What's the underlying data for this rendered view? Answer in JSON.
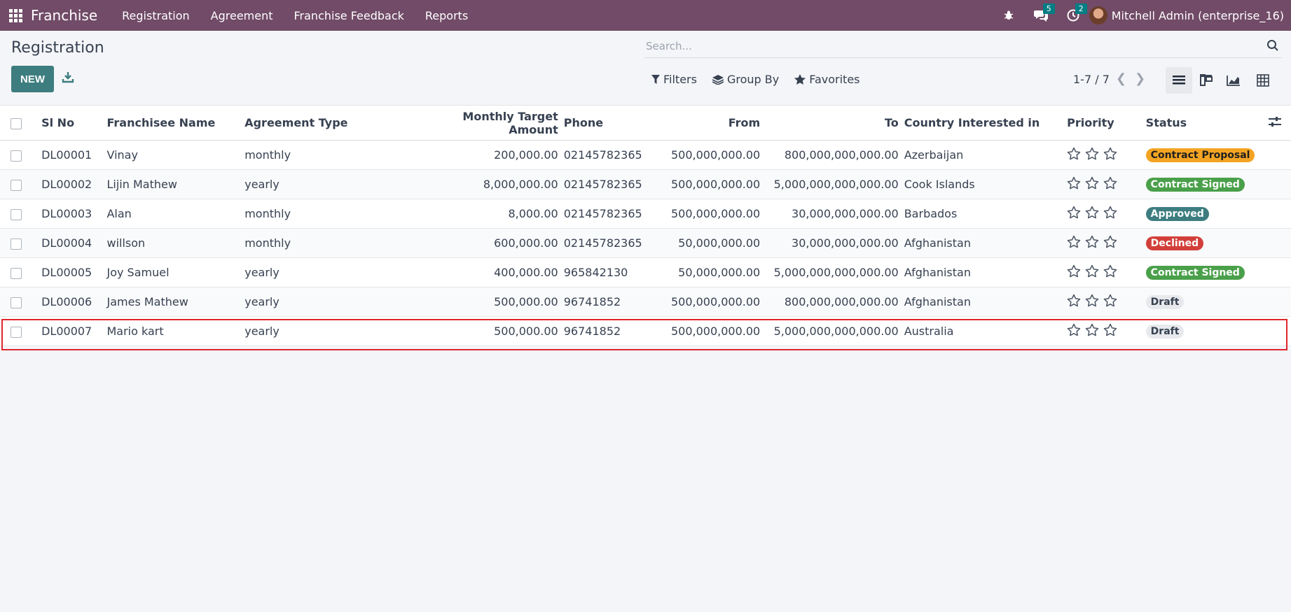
{
  "app": {
    "name": "Franchise"
  },
  "nav": {
    "menu": [
      "Registration",
      "Agreement",
      "Franchise Feedback",
      "Reports"
    ]
  },
  "systray": {
    "messages_count": "5",
    "activities_count": "2",
    "user": "Mitchell Admin (enterprise_16)"
  },
  "page": {
    "title": "Registration",
    "new_label": "NEW"
  },
  "search": {
    "placeholder": "Search..."
  },
  "filters": {
    "filters_label": "Filters",
    "group_by_label": "Group By",
    "favorites_label": "Favorites"
  },
  "pager": {
    "text": "1-7 / 7"
  },
  "table": {
    "columns": [
      "Sl No",
      "Franchisee Name",
      "Agreement Type",
      "Monthly Target Amount",
      "Phone",
      "From",
      "To",
      "Country Interested in",
      "Priority",
      "Status"
    ],
    "rows": [
      {
        "sl": "DL00001",
        "name": "Vinay",
        "type": "monthly",
        "target": "200,000.00",
        "phone": "02145782365",
        "from": "500,000,000.00",
        "to": "800,000,000,000.00",
        "country": "Azerbaijan",
        "status": "Contract Proposal",
        "status_color": "#f3a423",
        "status_text_color": "#1f1f1f"
      },
      {
        "sl": "DL00002",
        "name": "Lijin Mathew",
        "type": "yearly",
        "target": "8,000,000.00",
        "phone": "02145782365",
        "from": "500,000,000.00",
        "to": "5,000,000,000,000.00",
        "country": "Cook Islands",
        "status": "Contract Signed",
        "status_color": "#4aa04a",
        "status_text_color": "#ffffff"
      },
      {
        "sl": "DL00003",
        "name": "Alan",
        "type": "monthly",
        "target": "8,000.00",
        "phone": "02145782365",
        "from": "500,000,000.00",
        "to": "30,000,000,000.00",
        "country": "Barbados",
        "status": "Approved",
        "status_color": "#3d7d80",
        "status_text_color": "#ffffff"
      },
      {
        "sl": "DL00004",
        "name": "willson",
        "type": "monthly",
        "target": "600,000.00",
        "phone": "02145782365",
        "from": "50,000,000.00",
        "to": "30,000,000,000.00",
        "country": "Afghanistan",
        "status": "Declined",
        "status_color": "#d23f3a",
        "status_text_color": "#ffffff"
      },
      {
        "sl": "DL00005",
        "name": "Joy Samuel",
        "type": "yearly",
        "target": "400,000.00",
        "phone": "965842130",
        "from": "50,000,000.00",
        "to": "5,000,000,000,000.00",
        "country": "Afghanistan",
        "status": "Contract Signed",
        "status_color": "#4aa04a",
        "status_text_color": "#ffffff"
      },
      {
        "sl": "DL00006",
        "name": "James Mathew",
        "type": "yearly",
        "target": "500,000.00",
        "phone": "96741852",
        "from": "500,000,000.00",
        "to": "800,000,000,000.00",
        "country": "Afghanistan",
        "status": "Draft",
        "status_color": "#e7e9ed",
        "status_text_color": "#374151"
      },
      {
        "sl": "DL00007",
        "name": "Mario kart",
        "type": "yearly",
        "target": "500,000.00",
        "phone": "96741852",
        "from": "500,000,000.00",
        "to": "5,000,000,000,000.00",
        "country": "Australia",
        "status": "Draft",
        "status_color": "#e7e9ed",
        "status_text_color": "#374151"
      }
    ]
  },
  "colors": {
    "navbar": "#714b67",
    "primary": "#3d7d80",
    "highlight": "#e0262c"
  }
}
